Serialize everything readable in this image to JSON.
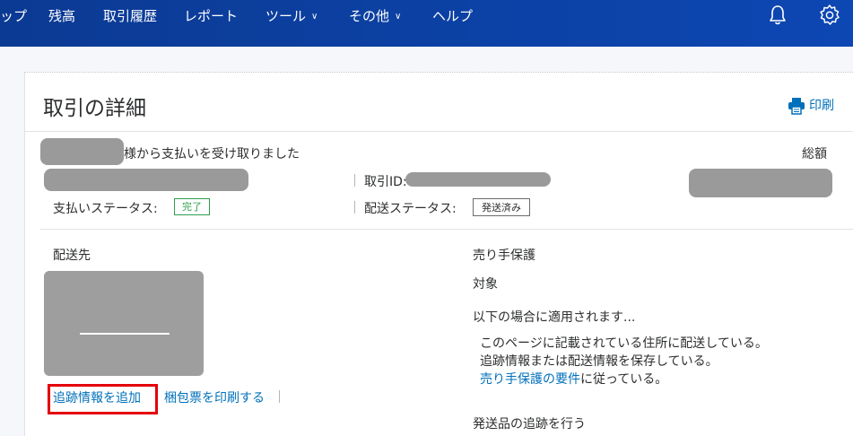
{
  "nav": {
    "items": [
      "ップ",
      "残高",
      "取引履歴",
      "レポート",
      "ツール",
      "その他",
      "ヘルプ"
    ],
    "dropdown_chevron": "∨"
  },
  "page": {
    "title": "取引の詳細",
    "print_label": "印刷",
    "received_from": "様から支払いを受け取りました",
    "total_label": "総額",
    "txn_id_label": "取引ID:",
    "payment_status_label": "支払いステータス:",
    "payment_status": "完了",
    "shipping_status_label": "配送ステータス:",
    "shipping_status": "発送済み"
  },
  "shipping": {
    "label": "配送先",
    "add_tracking": "追跡情報を追加",
    "print_label": "梱包票を印刷する"
  },
  "protection": {
    "title": "売り手保護",
    "eligibility": "対象",
    "applies_when": "以下の場合に適用されます...",
    "conditions": [
      "このページに記載されている住所に配送している。",
      "追跡情報または配送情報を保存している。"
    ],
    "requirements_link": "売り手保護の要件",
    "requirements_suffix": "に従っている。",
    "track_shipment": "発送品の追跡を行う"
  },
  "colors": {
    "nav_bg": "#0d47b3",
    "link": "#0070ba",
    "status_green": "#2e9e4f",
    "highlight_red": "#e3000b"
  },
  "icons": {
    "bell": "bell-icon",
    "settings": "gear-icon",
    "print": "printer-icon"
  }
}
